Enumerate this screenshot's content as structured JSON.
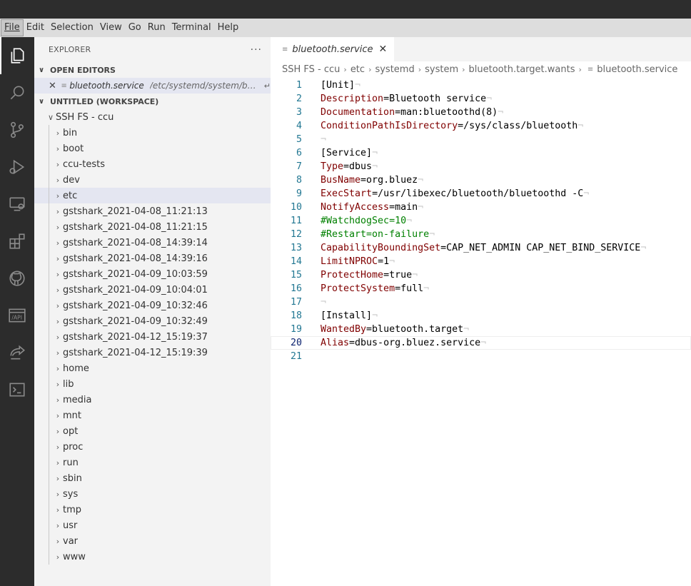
{
  "menubar": {
    "items": [
      "File",
      "Edit",
      "Selection",
      "View",
      "Go",
      "Run",
      "Terminal",
      "Help"
    ]
  },
  "activitybar": {
    "icons": [
      "explorer-icon",
      "search-icon",
      "source-control-icon",
      "run-debug-icon",
      "remote-explorer-icon",
      "extensions-icon",
      "github-icon",
      "api-icon",
      "live-share-icon",
      "terminal-icon"
    ]
  },
  "sidebar": {
    "title": "EXPLORER",
    "more": "···",
    "open_editors_label": "OPEN EDITORS",
    "open_editor": {
      "name": "bluetooth.service",
      "path": "/etc/systemd/system/blu..."
    },
    "workspace_label": "UNTITLED (WORKSPACE)",
    "root": "SSH FS - ccu",
    "folders": [
      "bin",
      "boot",
      "ccu-tests",
      "dev",
      "etc",
      "gstshark_2021-04-08_11:21:13",
      "gstshark_2021-04-08_11:21:15",
      "gstshark_2021-04-08_14:39:14",
      "gstshark_2021-04-08_14:39:16",
      "gstshark_2021-04-09_10:03:59",
      "gstshark_2021-04-09_10:04:01",
      "gstshark_2021-04-09_10:32:46",
      "gstshark_2021-04-09_10:32:49",
      "gstshark_2021-04-12_15:19:37",
      "gstshark_2021-04-12_15:19:39",
      "home",
      "lib",
      "media",
      "mnt",
      "opt",
      "proc",
      "run",
      "sbin",
      "sys",
      "tmp",
      "usr",
      "var",
      "www"
    ],
    "selected_folder": "etc"
  },
  "editor": {
    "tab_label": "bluetooth.service",
    "breadcrumb": [
      "SSH FS - ccu",
      "etc",
      "systemd",
      "system",
      "bluetooth.target.wants",
      "bluetooth.service"
    ],
    "current_line": 20,
    "lines": [
      [
        {
          "t": "[Unit]",
          "c": "txt"
        }
      ],
      [
        {
          "t": "Description",
          "c": "k"
        },
        {
          "t": "=Bluetooth service",
          "c": "v"
        }
      ],
      [
        {
          "t": "Documentation",
          "c": "k"
        },
        {
          "t": "=man:bluetoothd(8)",
          "c": "v"
        }
      ],
      [
        {
          "t": "ConditionPathIsDirectory",
          "c": "k"
        },
        {
          "t": "=/sys/class/bluetooth",
          "c": "v"
        }
      ],
      [],
      [
        {
          "t": "[Service]",
          "c": "txt"
        }
      ],
      [
        {
          "t": "Type",
          "c": "k"
        },
        {
          "t": "=dbus",
          "c": "v"
        }
      ],
      [
        {
          "t": "BusName",
          "c": "k"
        },
        {
          "t": "=org.bluez",
          "c": "v"
        }
      ],
      [
        {
          "t": "ExecStart",
          "c": "k"
        },
        {
          "t": "=/usr/libexec/bluetooth/bluetoothd -C",
          "c": "v"
        }
      ],
      [
        {
          "t": "NotifyAccess",
          "c": "k"
        },
        {
          "t": "=main",
          "c": "v"
        }
      ],
      [
        {
          "t": "#WatchdogSec=10",
          "c": "c"
        }
      ],
      [
        {
          "t": "#Restart=on-failure",
          "c": "c"
        }
      ],
      [
        {
          "t": "CapabilityBoundingSet",
          "c": "k"
        },
        {
          "t": "=CAP_NET_ADMIN CAP_NET_BIND_SERVICE",
          "c": "v"
        }
      ],
      [
        {
          "t": "LimitNPROC",
          "c": "k"
        },
        {
          "t": "=1",
          "c": "v"
        }
      ],
      [
        {
          "t": "ProtectHome",
          "c": "k"
        },
        {
          "t": "=true",
          "c": "v"
        }
      ],
      [
        {
          "t": "ProtectSystem",
          "c": "k"
        },
        {
          "t": "=full",
          "c": "v"
        }
      ],
      [],
      [
        {
          "t": "[Install]",
          "c": "txt"
        }
      ],
      [
        {
          "t": "WantedBy",
          "c": "k"
        },
        {
          "t": "=bluetooth.target",
          "c": "v"
        }
      ],
      [
        {
          "t": "Alias",
          "c": "k"
        },
        {
          "t": "=dbus-org.bluez.service",
          "c": "v"
        }
      ],
      []
    ],
    "eol_marker": "¬"
  }
}
